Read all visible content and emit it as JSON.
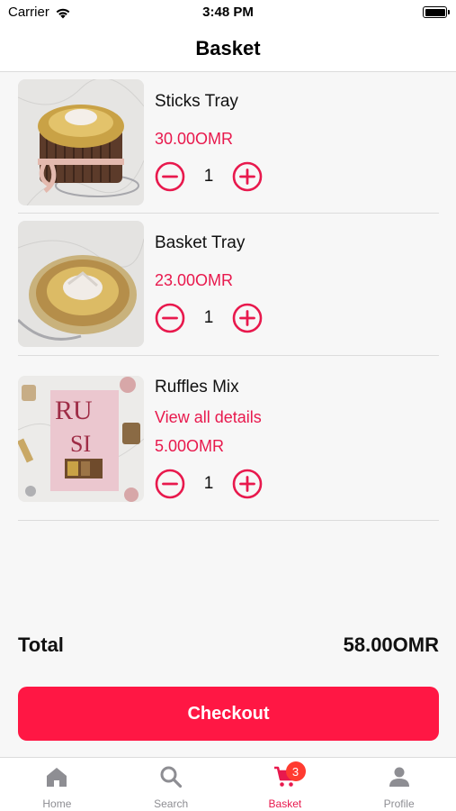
{
  "status_bar": {
    "carrier": "Carrier",
    "time": "3:48 PM"
  },
  "nav": {
    "title": "Basket"
  },
  "items": [
    {
      "name": "Sticks Tray",
      "price": "30.00OMR",
      "quantity": "1"
    },
    {
      "name": "Basket Tray",
      "price": "23.00OMR",
      "quantity": "1"
    },
    {
      "name": "Ruffles Mix",
      "link": "View all details",
      "price": "5.00OMR",
      "quantity": "1"
    }
  ],
  "summary": {
    "total_label": "Total",
    "total_value": "58.00OMR"
  },
  "checkout": {
    "label": "Checkout"
  },
  "tabs": [
    {
      "label": "Home",
      "icon": "home-icon"
    },
    {
      "label": "Search",
      "icon": "search-icon"
    },
    {
      "label": "Basket",
      "icon": "cart-icon",
      "badge": "3",
      "active": true
    },
    {
      "label": "Profile",
      "icon": "person-icon"
    }
  ],
  "colors": {
    "accent": "#e8194d",
    "button": "#ff1744",
    "badge": "#ff3b30",
    "inactive_tab": "#8e8e93"
  }
}
